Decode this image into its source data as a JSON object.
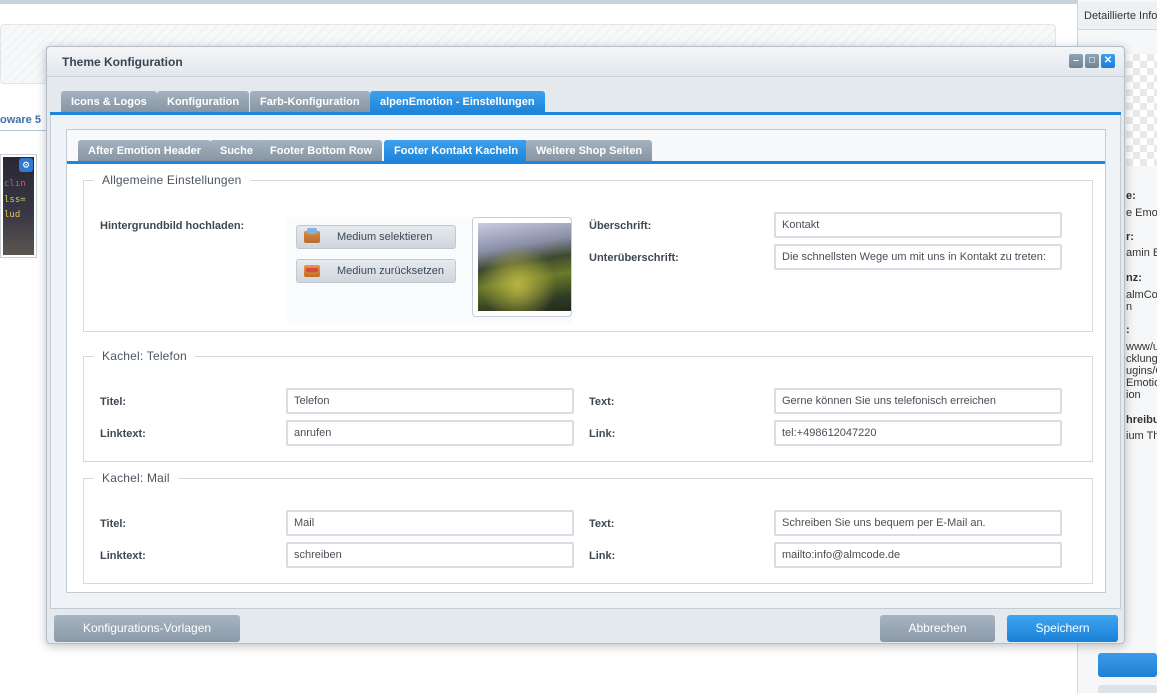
{
  "background": {
    "left_label": "oware 5",
    "code_lines": [
      "clın",
      "lss=",
      "lud"
    ],
    "right_panel": {
      "title": "Detaillierte Info",
      "fragments": [
        "e:",
        "e Emoti",
        "r:",
        "amin Be",
        "nz:",
        "almCo",
        "n",
        ":",
        "www/us",
        "cklung",
        "ugins/C",
        "Emotio",
        "ion",
        "hreibu",
        "ium Th"
      ]
    }
  },
  "modal": {
    "title": "Theme Konfiguration",
    "window_buttons": [
      "minimize",
      "maximize",
      "close"
    ],
    "outer_tabs": [
      {
        "label": "Icons & Logos",
        "active": false
      },
      {
        "label": "Konfiguration",
        "active": false
      },
      {
        "label": "Farb-Konfiguration",
        "active": false
      },
      {
        "label": "alpenEmotion - Einstellungen",
        "active": true
      }
    ],
    "inner_tabs": [
      {
        "label": "After Emotion Header",
        "active": false
      },
      {
        "label": "Suche",
        "active": false
      },
      {
        "label": "Footer Bottom Row",
        "active": false
      },
      {
        "label": "Footer Kontakt Kacheln",
        "active": true
      },
      {
        "label": "Weitere Shop Seiten",
        "active": false
      }
    ],
    "general": {
      "legend": "Allgemeine Einstellungen",
      "bg_label": "Hintergrundbild hochladen:",
      "select_media": "Medium selektieren",
      "reset_media": "Medium zurücksetzen",
      "heading_label": "Überschrift:",
      "heading_value": "Kontakt",
      "subheading_label": "Unterüberschrift:",
      "subheading_value": "Die schnellsten Wege um mit uns in Kontakt zu treten:"
    },
    "phone": {
      "legend": "Kachel: Telefon",
      "title_label": "Titel:",
      "title_value": "Telefon",
      "linktext_label": "Linktext:",
      "linktext_value": "anrufen",
      "text_label": "Text:",
      "text_value": "Gerne können Sie uns telefonisch erreichen",
      "link_label": "Link:",
      "link_value": "tel:+498612047220"
    },
    "mail": {
      "legend": "Kachel: Mail",
      "title_label": "Titel:",
      "title_value": "Mail",
      "linktext_label": "Linktext:",
      "linktext_value": "schreiben",
      "text_label": "Text:",
      "text_value": "Schreiben Sie uns bequem per E-Mail an.",
      "link_label": "Link:",
      "link_value": "mailto:info@almcode.de"
    },
    "footer": {
      "templates": "Konfigurations-Vorlagen",
      "cancel": "Abbrechen",
      "save": "Speichern"
    }
  },
  "colors": {
    "accent": "#1e86dc",
    "tab_inactive": "#8594a3"
  }
}
